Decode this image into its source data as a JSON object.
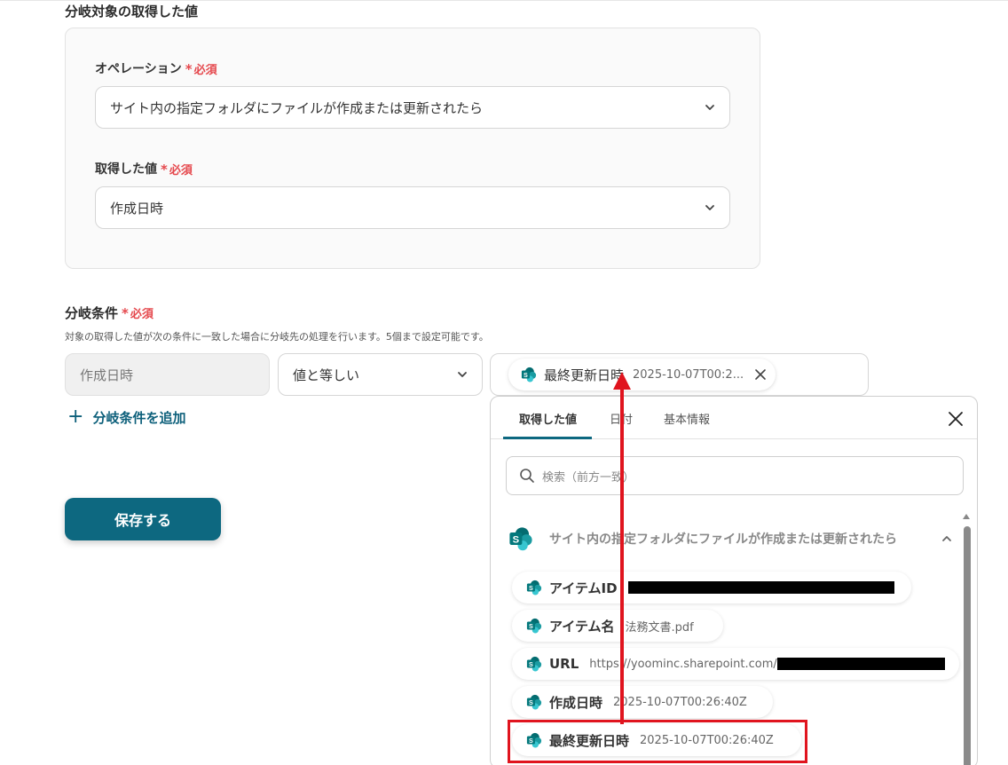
{
  "section": {
    "heading": "分岐対象の取得した値"
  },
  "operation": {
    "label": "オペレーション",
    "required": "必須",
    "value": "サイト内の指定フォルダにファイルが作成または更新されたら"
  },
  "acquired": {
    "label": "取得した値",
    "required": "必須",
    "value": "作成日時"
  },
  "condition": {
    "label": "分岐条件",
    "required": "必須",
    "description": "対象の取得した値が次の条件に一致した場合に分岐先の処理を行います。5個まで設定可能です。",
    "field": "作成日時",
    "operator": "値と等しい",
    "chip_name": "最終更新日時",
    "chip_value": "2025-10-07T00:2...",
    "add_label": "分岐条件を追加"
  },
  "save_label": "保存する",
  "dropdown": {
    "tabs": [
      "取得した値",
      "日付",
      "基本情報"
    ],
    "search_placeholder": "検索（前方一致）",
    "group_title": "サイト内の指定フォルダにファイルが作成または更新されたら",
    "items": [
      {
        "name": "アイテムID",
        "value": ""
      },
      {
        "name": "アイテム名",
        "value": "法務文書.pdf"
      },
      {
        "name": "URL",
        "value": "https://yoominc.sharepoint.com/"
      },
      {
        "name": "作成日時",
        "value": "2025-10-07T00:26:40Z"
      },
      {
        "name": "最終更新日時",
        "value": "2025-10-07T00:26:40Z"
      }
    ]
  },
  "colors": {
    "accent": "#0d6880",
    "required": "#e5484d",
    "annotation": "#e0141e"
  }
}
